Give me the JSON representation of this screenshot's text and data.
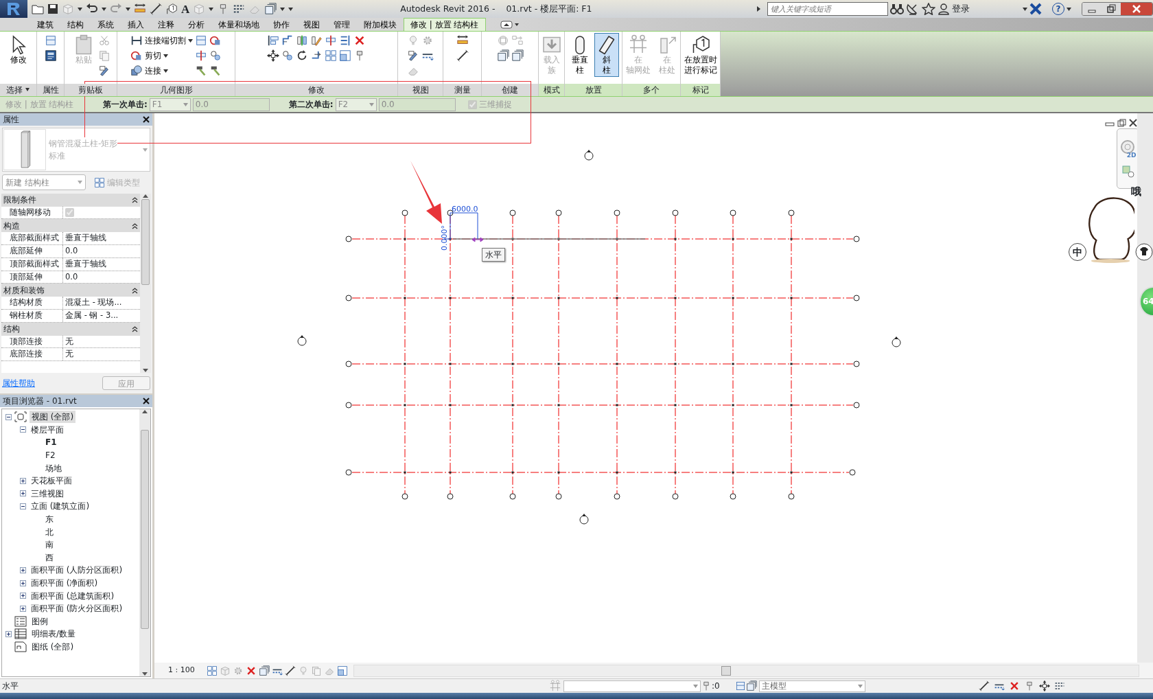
{
  "title_bar": {
    "title": "Autodesk Revit 2016 -    01.rvt - 楼层平面: F1",
    "text_tool": "A",
    "search": {
      "placeholder": "键入关键字或短语"
    },
    "login": "登录",
    "help": "?"
  },
  "tabs": [
    {
      "label": "建筑",
      "selected": false
    },
    {
      "label": "结构",
      "selected": false
    },
    {
      "label": "系统",
      "selected": false
    },
    {
      "label": "插入",
      "selected": false
    },
    {
      "label": "注释",
      "selected": false
    },
    {
      "label": "分析",
      "selected": false
    },
    {
      "label": "体量和场地",
      "selected": false
    },
    {
      "label": "协作",
      "selected": false
    },
    {
      "label": "视图",
      "selected": false
    },
    {
      "label": "管理",
      "selected": false
    },
    {
      "label": "附加模块",
      "selected": false
    },
    {
      "label": "修改 | 放置 结构柱",
      "selected": true
    }
  ],
  "ribbon": [
    {
      "label": "选择",
      "menu": true,
      "contextual": false,
      "tools": [
        {
          "kind": "large",
          "lines": [
            "修改"
          ],
          "selected": false,
          "disabled": false
        }
      ]
    },
    {
      "label": "属性",
      "menu": false,
      "contextual": false
    },
    {
      "label": "剪贴板",
      "menu": false,
      "contextual": false,
      "tools": [
        {
          "kind": "large",
          "lines": [
            "粘贴"
          ],
          "selected": false,
          "disabled": true
        }
      ]
    },
    {
      "label": "几何图形",
      "menu": false,
      "contextual": false,
      "tools": [
        {
          "kind": "small",
          "label": "连接端切割",
          "menu": true
        },
        {
          "kind": "small",
          "label": "剪切",
          "menu": true
        },
        {
          "kind": "small",
          "label": "连接",
          "menu": true
        }
      ]
    },
    {
      "label": "修改",
      "menu": false,
      "contextual": false
    },
    {
      "label": "视图",
      "menu": false,
      "contextual": false
    },
    {
      "label": "测量",
      "menu": false,
      "contextual": false
    },
    {
      "label": "创建",
      "menu": false,
      "contextual": false
    },
    {
      "label": "模式",
      "menu": false,
      "contextual": true,
      "tools": [
        {
          "kind": "large",
          "lines": [
            "载入",
            "族"
          ],
          "selected": false,
          "disabled": true
        }
      ]
    },
    {
      "label": "放置",
      "menu": false,
      "contextual": true,
      "tools": [
        {
          "kind": "large",
          "lines": [
            "垂直",
            "柱"
          ],
          "selected": false,
          "disabled": false
        },
        {
          "kind": "large",
          "lines": [
            "斜",
            "柱"
          ],
          "selected": true,
          "disabled": false
        }
      ]
    },
    {
      "label": "多个",
      "menu": false,
      "contextual": true,
      "tools": [
        {
          "kind": "large",
          "lines": [
            "在",
            "轴网处"
          ],
          "selected": false,
          "disabled": true
        },
        {
          "kind": "large",
          "lines": [
            "在",
            "柱处"
          ],
          "selected": false,
          "disabled": true
        }
      ]
    },
    {
      "label": "标记",
      "menu": false,
      "contextual": true,
      "tools": [
        {
          "kind": "large",
          "lines": [
            "在放置时",
            "进行标记"
          ],
          "selected": false,
          "disabled": false
        }
      ]
    }
  ],
  "options_bar": {
    "context": "修改 | 放置 结构柱",
    "first_click_label": "第一次单击:",
    "first_click": "F1",
    "first_value": "0.0",
    "second_click_label": "第二次单击:",
    "second_click": "F2",
    "second_value": "0.0",
    "snap": {
      "label": "三维捕捉",
      "checked": true
    }
  },
  "properties": {
    "title": "属性",
    "type_name": "钢管混凝土柱-矩形",
    "type_sub": "标准",
    "instance_filter": "新建 结构柱",
    "edit_type": {
      "label": "编辑类型",
      "disabled": true
    },
    "groups": [
      {
        "name": "限制条件",
        "rows": [
          {
            "kind": "checkbox",
            "name": "随轴网移动",
            "checked": true
          }
        ]
      },
      {
        "name": "构造",
        "rows": [
          {
            "kind": "text",
            "name": "底部截面样式",
            "value": "垂直于轴线"
          },
          {
            "kind": "text",
            "name": "底部延伸",
            "value": "0.0"
          },
          {
            "kind": "text",
            "name": "顶部截面样式",
            "value": "垂直于轴线"
          },
          {
            "kind": "text",
            "name": "顶部延伸",
            "value": "0.0"
          }
        ]
      },
      {
        "name": "材质和装饰",
        "rows": [
          {
            "kind": "text",
            "name": "结构材质",
            "value": "混凝土 - 现场..."
          },
          {
            "kind": "text",
            "name": "钢柱材质",
            "value": "金属 - 钢 - 3..."
          }
        ]
      },
      {
        "name": "结构",
        "rows": [
          {
            "kind": "text",
            "name": "顶部连接",
            "value": "无"
          },
          {
            "kind": "text",
            "name": "底部连接",
            "value": "无"
          }
        ]
      }
    ],
    "help": "属性帮助",
    "apply": {
      "label": "应用",
      "disabled": true
    }
  },
  "project_browser": {
    "title": "项目浏览器 - 01.rvt",
    "tree": [
      {
        "label": "视图 (全部)",
        "kind": "views",
        "expanded": true,
        "selected": true,
        "children": [
          {
            "label": "楼层平面",
            "expanded": true,
            "selected": false,
            "children": [
              {
                "label": "F1",
                "current": true,
                "selected": false
              },
              {
                "label": "F2",
                "current": false,
                "selected": false
              },
              {
                "label": "场地",
                "current": false,
                "selected": false
              }
            ]
          },
          {
            "label": "天花板平面",
            "expanded": false,
            "selected": false
          },
          {
            "label": "三维视图",
            "expanded": false,
            "selected": false
          },
          {
            "label": "立面 (建筑立面)",
            "expanded": true,
            "selected": false,
            "children": [
              {
                "label": "东",
                "selected": false
              },
              {
                "label": "北",
                "selected": false
              },
              {
                "label": "南",
                "selected": false
              },
              {
                "label": "西",
                "selected": false
              }
            ]
          },
          {
            "label": "面积平面 (人防分区面积)",
            "expanded": false,
            "selected": false
          },
          {
            "label": "面积平面 (净面积)",
            "expanded": false,
            "selected": false
          },
          {
            "label": "面积平面 (总建筑面积)",
            "expanded": false,
            "selected": false
          },
          {
            "label": "面积平面 (防火分区面积)",
            "expanded": false,
            "selected": false
          }
        ]
      },
      {
        "label": "图例",
        "kind": "legend",
        "selected": false
      },
      {
        "label": "明细表/数量",
        "kind": "schedule",
        "expanded": false,
        "selected": false
      },
      {
        "label": "图纸 (全部)",
        "kind": "sheet",
        "selected": false
      }
    ]
  },
  "canvas": {
    "dimension": "6000.0",
    "angle": "0.000°",
    "tooltip": "水平",
    "nav_label": "2D"
  },
  "view_bar": {
    "scale": "1 : 100"
  },
  "status_bar": {
    "message": "水平",
    "selection_count": ":0",
    "model": "主模型"
  },
  "overlay": {
    "exclaim": "哦",
    "ime_mode": "中",
    "badge": "64"
  }
}
